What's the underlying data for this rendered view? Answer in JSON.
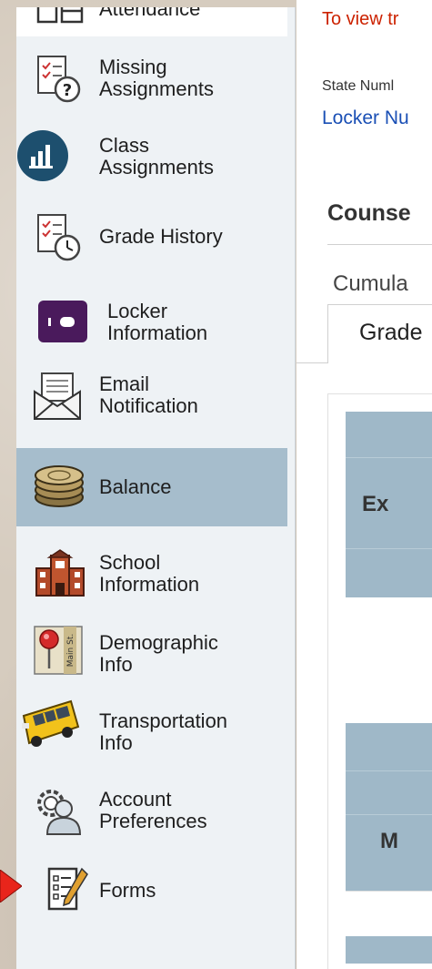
{
  "sidebar": {
    "items": [
      {
        "label": "Attendance",
        "icon": "attendance-icon"
      },
      {
        "label": "Missing\nAssignments",
        "icon": "missing-assignments-icon"
      },
      {
        "label": "Class\nAssignments",
        "icon": "class-assignments-icon"
      },
      {
        "label": "Grade History",
        "icon": "grade-history-icon"
      },
      {
        "label": "Locker\nInformation",
        "icon": "locker-icon"
      },
      {
        "label": "Email\nNotification",
        "icon": "email-icon"
      },
      {
        "label": "Balance",
        "icon": "coins-icon",
        "active": true
      },
      {
        "label": "School\nInformation",
        "icon": "school-icon"
      },
      {
        "label": "Demographic\nInfo",
        "icon": "map-pin-icon"
      },
      {
        "label": "Transportation\nInfo",
        "icon": "school-bus-icon"
      },
      {
        "label": "Account\nPreferences",
        "icon": "account-icon"
      },
      {
        "label": "Forms",
        "icon": "forms-icon"
      }
    ]
  },
  "main": {
    "notice": "To view tr",
    "state_number_label": "State Numl",
    "locker_number_link": "Locker Nu",
    "counselor_heading": "Counse",
    "cumulative_label": "Cumula",
    "grade_tab": "Grade",
    "table1_header": "Ex",
    "table2_header": "M"
  },
  "colors": {
    "accent_active": "#a6bdcc",
    "notice_red": "#cc2200",
    "link_blue": "#1a4fb5",
    "table_header": "#9fb8c8",
    "annotation_arrow": "#e8251b"
  }
}
